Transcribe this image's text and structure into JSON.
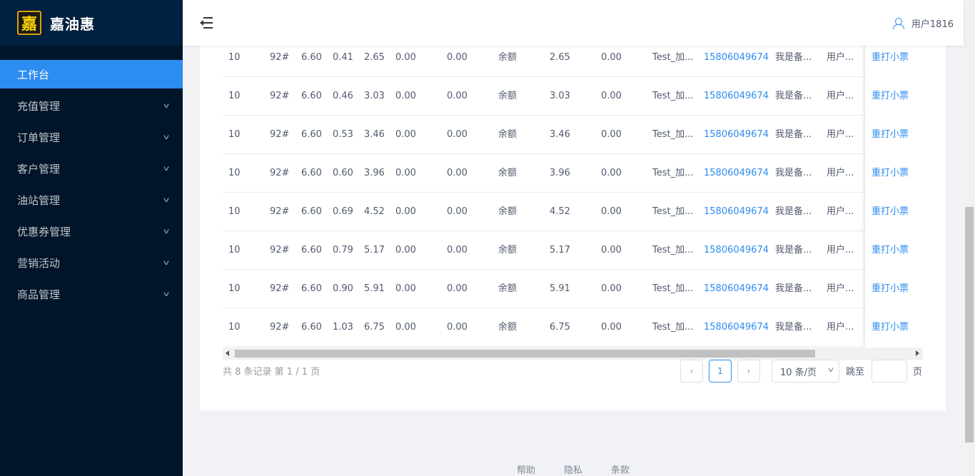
{
  "logo": {
    "mark": "嘉",
    "text": "嘉油惠"
  },
  "sidebar": {
    "items": [
      {
        "label": "工作台",
        "active": true,
        "has_children": false
      },
      {
        "label": "充值管理",
        "has_children": true
      },
      {
        "label": "订单管理",
        "has_children": true
      },
      {
        "label": "客户管理",
        "has_children": true
      },
      {
        "label": "油站管理",
        "has_children": true
      },
      {
        "label": "优惠券管理",
        "has_children": true
      },
      {
        "label": "营销活动",
        "has_children": true
      },
      {
        "label": "商品管理",
        "has_children": true
      }
    ]
  },
  "header": {
    "username": "用户1816"
  },
  "table": {
    "rows": [
      [
        "10",
        "92#",
        "6.60",
        "0.41",
        "2.65",
        "0.00",
        "0.00",
        "余额",
        "2.65",
        "0.00",
        "Test_加...",
        "15806049674",
        "我是备...",
        "用户...",
        "重打小票"
      ],
      [
        "10",
        "92#",
        "6.60",
        "0.46",
        "3.03",
        "0.00",
        "0.00",
        "余额",
        "3.03",
        "0.00",
        "Test_加...",
        "15806049674",
        "我是备...",
        "用户...",
        "重打小票"
      ],
      [
        "10",
        "92#",
        "6.60",
        "0.53",
        "3.46",
        "0.00",
        "0.00",
        "余额",
        "3.46",
        "0.00",
        "Test_加...",
        "15806049674",
        "我是备...",
        "用户...",
        "重打小票"
      ],
      [
        "10",
        "92#",
        "6.60",
        "0.60",
        "3.96",
        "0.00",
        "0.00",
        "余额",
        "3.96",
        "0.00",
        "Test_加...",
        "15806049674",
        "我是备...",
        "用户...",
        "重打小票"
      ],
      [
        "10",
        "92#",
        "6.60",
        "0.69",
        "4.52",
        "0.00",
        "0.00",
        "余额",
        "4.52",
        "0.00",
        "Test_加...",
        "15806049674",
        "我是备...",
        "用户...",
        "重打小票"
      ],
      [
        "10",
        "92#",
        "6.60",
        "0.79",
        "5.17",
        "0.00",
        "0.00",
        "余额",
        "5.17",
        "0.00",
        "Test_加...",
        "15806049674",
        "我是备...",
        "用户...",
        "重打小票"
      ],
      [
        "10",
        "92#",
        "6.60",
        "0.90",
        "5.91",
        "0.00",
        "0.00",
        "余额",
        "5.91",
        "0.00",
        "Test_加...",
        "15806049674",
        "我是备...",
        "用户...",
        "重打小票"
      ],
      [
        "10",
        "92#",
        "6.60",
        "1.03",
        "6.75",
        "0.00",
        "0.00",
        "余额",
        "6.75",
        "0.00",
        "Test_加...",
        "15806049674",
        "我是备...",
        "用户...",
        "重打小票"
      ]
    ]
  },
  "pagination": {
    "total_text": "共 8 条记录 第 1 / 1 页",
    "current_page": "1",
    "page_size": "10 条/页",
    "jump_label": "跳至",
    "jump_unit": "页",
    "prev_icon": "chevron-left-icon",
    "next_icon": "chevron-right-icon"
  },
  "footer": {
    "links": [
      "帮助",
      "隐私",
      "条款"
    ]
  },
  "colors": {
    "sidebar_bg": "#001529",
    "accent": "#2d8cf0",
    "link": "#2d8cf0"
  }
}
